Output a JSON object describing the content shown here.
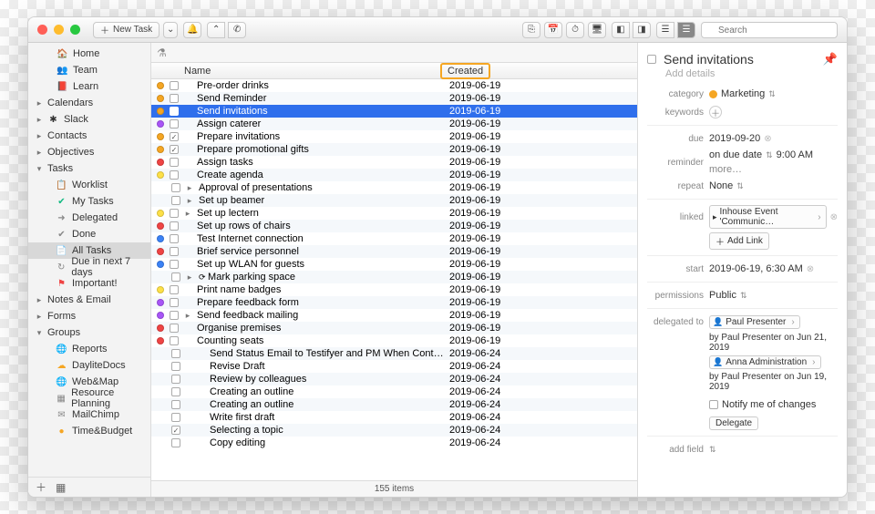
{
  "toolbar": {
    "new_task_label": "New Task",
    "search_placeholder": "Search"
  },
  "sidebar": {
    "items": [
      {
        "icon": "home",
        "label": "Home",
        "color": "ic-home"
      },
      {
        "icon": "team",
        "label": "Team",
        "color": "ic-team"
      },
      {
        "icon": "learn",
        "label": "Learn",
        "color": "ic-learn"
      }
    ],
    "sections": [
      {
        "label": "Calendars",
        "expand": true
      },
      {
        "label": "Slack",
        "expand": true,
        "icon": "slack"
      },
      {
        "label": "Contacts",
        "expand": true
      },
      {
        "label": "Objectives",
        "expand": true
      }
    ],
    "tasks_label": "Tasks",
    "tasks_children": [
      {
        "icon": "worklist",
        "label": "Worklist",
        "color": "ic-gray"
      },
      {
        "icon": "check",
        "label": "My Tasks",
        "color": "ic-done"
      },
      {
        "icon": "arrow-right",
        "label": "Delegated",
        "color": "ic-gray"
      },
      {
        "icon": "check-mute",
        "label": "Done",
        "color": "ic-gray"
      },
      {
        "icon": "list",
        "label": "All Tasks",
        "color": "ic-gray",
        "selected": true
      },
      {
        "icon": "clock",
        "label": "Due in next 7 days",
        "color": "ic-gray"
      },
      {
        "icon": "flag",
        "label": "Important!",
        "color": "ic-important"
      }
    ],
    "more_sections": [
      {
        "label": "Notes & Email",
        "expand": true
      },
      {
        "label": "Forms",
        "expand": true
      }
    ],
    "groups_label": "Groups",
    "groups": [
      {
        "icon": "globe",
        "label": "Reports",
        "color": "ic-blue"
      },
      {
        "icon": "cloud",
        "label": "DayliteDocs",
        "color": "ic-orange"
      },
      {
        "icon": "globe",
        "label": "Web&Map",
        "color": "ic-blue"
      },
      {
        "icon": "grid",
        "label": "Resource Planning",
        "color": "ic-gray"
      },
      {
        "icon": "mail",
        "label": "MailChimp",
        "color": "ic-gray"
      },
      {
        "icon": "coin",
        "label": "Time&Budget",
        "color": "ic-orange"
      }
    ]
  },
  "columns": {
    "name": "Name",
    "created": "Created"
  },
  "tasks": [
    {
      "c": "#f5a623",
      "chk": false,
      "name": "Pre-order drinks",
      "date": "2019-06-19"
    },
    {
      "c": "#f5a623",
      "chk": false,
      "name": "Send Reminder",
      "date": "2019-06-19"
    },
    {
      "c": "#f5a623",
      "chk": false,
      "name": "Send invitations",
      "date": "2019-06-19",
      "sel": true
    },
    {
      "c": "#a855f7",
      "chk": false,
      "name": "Assign caterer",
      "date": "2019-06-19"
    },
    {
      "c": "#f5a623",
      "chk": true,
      "name": "Prepare invitations",
      "date": "2019-06-19"
    },
    {
      "c": "#f5a623",
      "chk": true,
      "name": "Prepare promotional gifts",
      "date": "2019-06-19"
    },
    {
      "c": "#ef4444",
      "chk": false,
      "name": "Assign tasks",
      "date": "2019-06-19"
    },
    {
      "c": "#fde047",
      "chk": false,
      "name": "Create agenda",
      "date": "2019-06-19"
    },
    {
      "c": "",
      "chk": false,
      "name": "Approval of presentations",
      "date": "2019-06-19",
      "exp": true
    },
    {
      "c": "",
      "chk": false,
      "name": "Set up beamer",
      "date": "2019-06-19",
      "exp": true
    },
    {
      "c": "#fde047",
      "chk": false,
      "name": "Set up lectern",
      "date": "2019-06-19",
      "exp": true
    },
    {
      "c": "#ef4444",
      "chk": false,
      "name": "Set up rows of chairs",
      "date": "2019-06-19"
    },
    {
      "c": "#3b82f6",
      "chk": false,
      "name": "Test Internet connection",
      "date": "2019-06-19"
    },
    {
      "c": "#ef4444",
      "chk": false,
      "name": "Brief service personnel",
      "date": "2019-06-19"
    },
    {
      "c": "#3b82f6",
      "chk": false,
      "name": "Set up WLAN for guests",
      "date": "2019-06-19"
    },
    {
      "c": "",
      "chk": false,
      "name": "Mark parking space",
      "date": "2019-06-19",
      "exp": true,
      "reload": true
    },
    {
      "c": "#fde047",
      "chk": false,
      "name": "Print name badges",
      "date": "2019-06-19"
    },
    {
      "c": "#a855f7",
      "chk": false,
      "name": "Prepare feedback form",
      "date": "2019-06-19"
    },
    {
      "c": "#a855f7",
      "chk": false,
      "name": "Send feedback mailing",
      "date": "2019-06-19",
      "exp": true
    },
    {
      "c": "#ef4444",
      "chk": false,
      "name": "Organise premises",
      "date": "2019-06-19"
    },
    {
      "c": "#ef4444",
      "chk": false,
      "name": "Counting seats",
      "date": "2019-06-19"
    },
    {
      "c": "",
      "chk": false,
      "name": "Send Status Email to Testifyer and PM When Contract is R…",
      "date": "2019-06-24",
      "indent": true
    },
    {
      "c": "",
      "chk": false,
      "name": "Revise Draft",
      "date": "2019-06-24",
      "indent": true
    },
    {
      "c": "",
      "chk": false,
      "name": "Review by colleagues",
      "date": "2019-06-24",
      "indent": true
    },
    {
      "c": "",
      "chk": false,
      "name": "Creating an outline",
      "date": "2019-06-24",
      "indent": true
    },
    {
      "c": "",
      "chk": false,
      "name": "Creating an outline",
      "date": "2019-06-24",
      "indent": true
    },
    {
      "c": "",
      "chk": false,
      "name": "Write first draft",
      "date": "2019-06-24",
      "indent": true
    },
    {
      "c": "",
      "chk": true,
      "name": "Selecting a topic",
      "date": "2019-06-24",
      "indent": true
    },
    {
      "c": "",
      "chk": false,
      "name": "Copy editing",
      "date": "2019-06-24",
      "indent": true
    }
  ],
  "status": "155 items",
  "inspector": {
    "title": "Send invitations",
    "details_placeholder": "Add details",
    "category_label": "category",
    "category_value": "Marketing",
    "keywords_label": "keywords",
    "due_label": "due",
    "due_value": "2019-09-20",
    "reminder_label": "reminder",
    "reminder_value": "on due date",
    "reminder_time": "9:00 AM",
    "reminder_more": "more…",
    "repeat_label": "repeat",
    "repeat_value": "None",
    "linked_label": "linked",
    "linked_value": "Inhouse Event 'Communic…",
    "add_link": "Add Link",
    "start_label": "start",
    "start_value": "2019-06-19,  6:30 AM",
    "permissions_label": "permissions",
    "permissions_value": "Public",
    "delegated_label": "delegated to",
    "delegated_person": "Paul Presenter",
    "deleg_history_1": "by Paul Presenter on Jun 21, 2019",
    "anna": "Anna Administration",
    "deleg_history_2": "by Paul Presenter on Jun 19, 2019",
    "notify_label": "Notify me of changes",
    "delegate_btn": "Delegate",
    "add_field": "add field"
  }
}
